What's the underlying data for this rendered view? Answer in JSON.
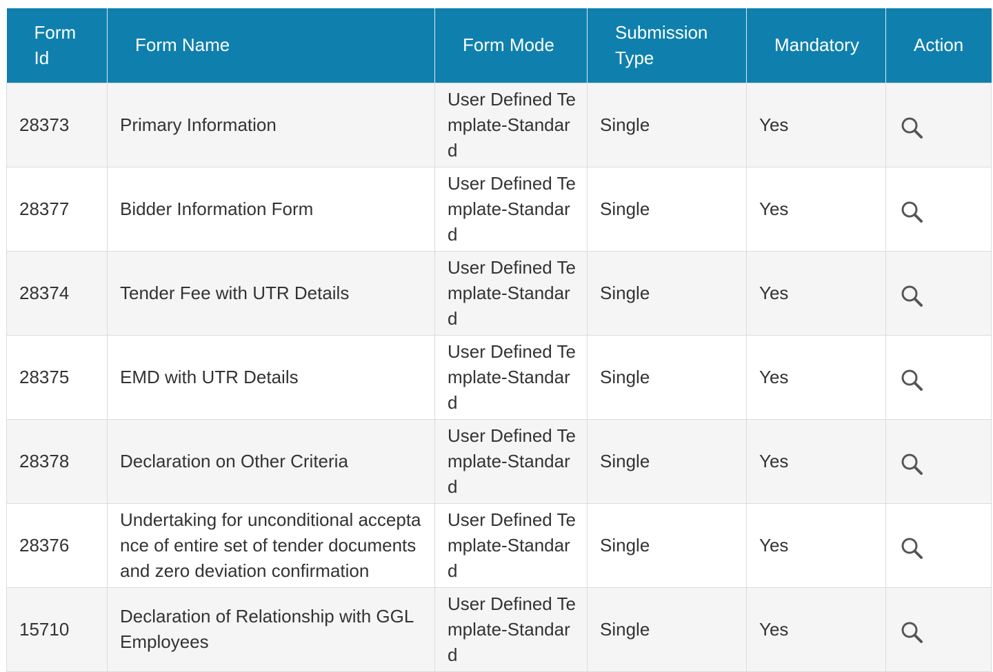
{
  "table": {
    "headers": {
      "form_id": "Form Id",
      "form_name": "Form Name",
      "form_mode": "Form Mode",
      "submission_type": "Submission Type",
      "mandatory": "Mandatory",
      "action": "Action"
    },
    "rows": [
      {
        "form_id": "28373",
        "form_name": "Primary Information",
        "form_mode": "User Defined Template-Standard",
        "submission_type": "Single",
        "mandatory": "Yes",
        "action_icon": "search-icon"
      },
      {
        "form_id": "28377",
        "form_name": "Bidder Information Form",
        "form_mode": "User Defined Template-Standard",
        "submission_type": "Single",
        "mandatory": "Yes",
        "action_icon": "search-icon"
      },
      {
        "form_id": "28374",
        "form_name": "Tender Fee with UTR Details",
        "form_mode": "User Defined Template-Standard",
        "submission_type": "Single",
        "mandatory": "Yes",
        "action_icon": "search-icon"
      },
      {
        "form_id": "28375",
        "form_name": "EMD with UTR Details",
        "form_mode": "User Defined Template-Standard",
        "submission_type": "Single",
        "mandatory": "Yes",
        "action_icon": "search-icon"
      },
      {
        "form_id": "28378",
        "form_name": "Declaration on Other Criteria",
        "form_mode": "User Defined Template-Standard",
        "submission_type": "Single",
        "mandatory": "Yes",
        "action_icon": "search-icon"
      },
      {
        "form_id": "28376",
        "form_name": "Undertaking for unconditional acceptance of entire set of tender documents and zero deviation confirmation",
        "form_mode": "User Defined Template-Standard",
        "submission_type": "Single",
        "mandatory": "Yes",
        "action_icon": "search-icon"
      },
      {
        "form_id": "15710",
        "form_name": "Declaration of Relationship with GGL Employees",
        "form_mode": "User Defined Template-Standard",
        "submission_type": "Single",
        "mandatory": "Yes",
        "action_icon": "search-icon"
      }
    ]
  },
  "colors": {
    "header_bg": "#0f80ad",
    "header_text": "#ffffff",
    "row_odd_bg": "#f5f5f5",
    "row_even_bg": "#ffffff",
    "body_text": "#333333",
    "icon": "#555555"
  }
}
